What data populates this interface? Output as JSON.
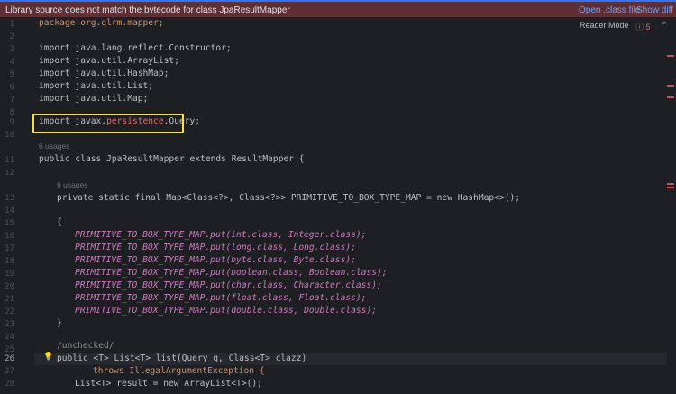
{
  "banner": {
    "message": "Library source does not match the bytecode for class JpaResultMapper",
    "open_label": "Open .class file",
    "diff_label": "Show diff"
  },
  "toolbar": {
    "reader_mode": "Reader Mode",
    "error_count": "ⓘ 5",
    "expand": "^"
  },
  "line_numbers": [
    "1",
    "2",
    "3",
    "4",
    "5",
    "6",
    "7",
    "8",
    "9",
    "10",
    "11",
    "12",
    "13",
    "14",
    "15",
    "16",
    "17",
    "18",
    "19",
    "20",
    "21",
    "22",
    "23",
    "24",
    "25",
    "26",
    "27",
    "28"
  ],
  "hints": {
    "usages_class": "6 usages",
    "usages_field": "9 usages"
  },
  "code": {
    "l1": "package org.qlrm.mapper;",
    "l3": "import java.lang.reflect.Constructor;",
    "l4": "import java.util.ArrayList;",
    "l5": "import java.util.HashMap;",
    "l6": "import java.util.List;",
    "l7": "import java.util.Map;",
    "l9a": "import javax.",
    "l9b": "persistence",
    "l9c": ".Query;",
    "l11": "public class JpaResultMapper extends ResultMapper {",
    "l13": "private static final Map<Class<?>, Class<?>> PRIMITIVE_TO_BOX_TYPE_MAP = new HashMap<>();",
    "l15": "{",
    "l16": "PRIMITIVE_TO_BOX_TYPE_MAP.put(int.class, Integer.class);",
    "l17": "PRIMITIVE_TO_BOX_TYPE_MAP.put(long.class, Long.class);",
    "l18": "PRIMITIVE_TO_BOX_TYPE_MAP.put(byte.class, Byte.class);",
    "l19": "PRIMITIVE_TO_BOX_TYPE_MAP.put(boolean.class, Boolean.class);",
    "l20": "PRIMITIVE_TO_BOX_TYPE_MAP.put(char.class, Character.class);",
    "l21": "PRIMITIVE_TO_BOX_TYPE_MAP.put(float.class, Float.class);",
    "l22": "PRIMITIVE_TO_BOX_TYPE_MAP.put(double.class, Double.class);",
    "l23": "}",
    "l25": "/unchecked/",
    "l26": "public <T> List<T> list(Query q, Class<T> clazz)",
    "l27": "throws IllegalArgumentException {",
    "l28": "List<T> result = new ArrayList<T>();"
  }
}
